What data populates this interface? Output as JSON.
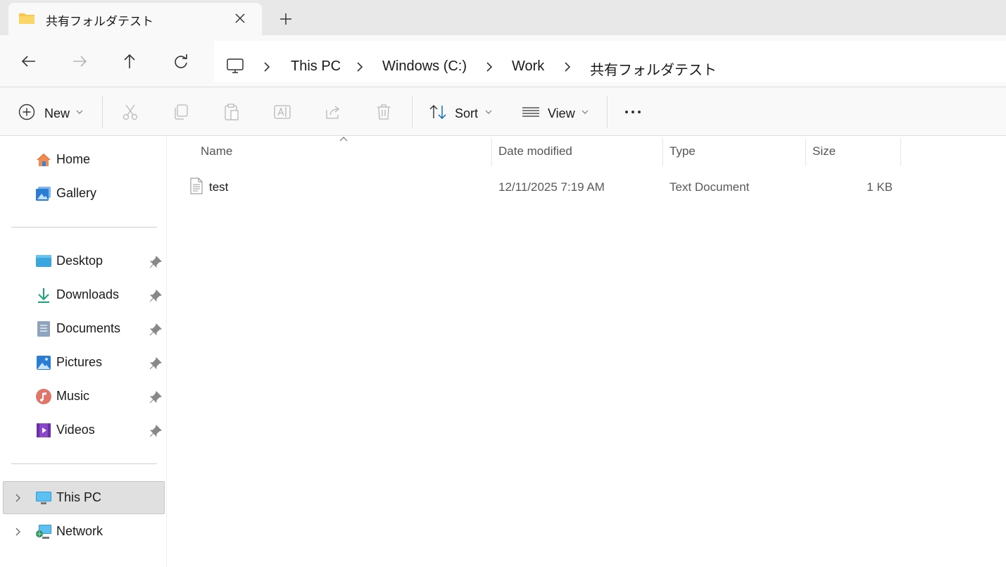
{
  "window": {
    "tab_title": "共有フォルダテスト",
    "tab_icon": "folder-icon",
    "close_icon": "close-icon",
    "new_tab_icon": "plus-icon"
  },
  "nav": {
    "back_icon": "arrow-left-icon",
    "forward_icon": "arrow-right-icon",
    "up_icon": "arrow-up-icon",
    "refresh_icon": "refresh-icon"
  },
  "breadcrumb": {
    "root_icon": "monitor-icon",
    "items": [
      "This PC",
      "Windows (C:)",
      "Work",
      "共有フォルダテスト"
    ]
  },
  "toolbar": {
    "new_label": "New",
    "sort_label": "Sort",
    "view_label": "View",
    "icons": [
      "cut-icon",
      "copy-icon",
      "paste-icon",
      "rename-icon",
      "share-icon",
      "delete-icon",
      "more-icon"
    ]
  },
  "sidebar": {
    "top": [
      {
        "label": "Home",
        "icon": "home-icon"
      },
      {
        "label": "Gallery",
        "icon": "gallery-icon"
      }
    ],
    "pinned": [
      {
        "label": "Desktop",
        "icon": "desktop-icon"
      },
      {
        "label": "Downloads",
        "icon": "download-icon"
      },
      {
        "label": "Documents",
        "icon": "documents-icon"
      },
      {
        "label": "Pictures",
        "icon": "pictures-icon"
      },
      {
        "label": "Music",
        "icon": "music-icon"
      },
      {
        "label": "Videos",
        "icon": "videos-icon"
      }
    ],
    "bottom": [
      {
        "label": "This PC",
        "icon": "computer-icon",
        "selected": true
      },
      {
        "label": "Network",
        "icon": "network-icon",
        "selected": false
      }
    ]
  },
  "file_list": {
    "columns": [
      "Name",
      "Date modified",
      "Type",
      "Size"
    ],
    "sort_column": "Name",
    "rows": [
      {
        "name": "test",
        "date_modified": "12/11/2025 7:19 AM",
        "type": "Text Document",
        "size": "1 KB",
        "icon": "text-file-icon"
      }
    ]
  },
  "colors": {
    "accent": "#0067c0",
    "folder": "#f8c74a",
    "selected_bg": "#e0e0e0"
  }
}
